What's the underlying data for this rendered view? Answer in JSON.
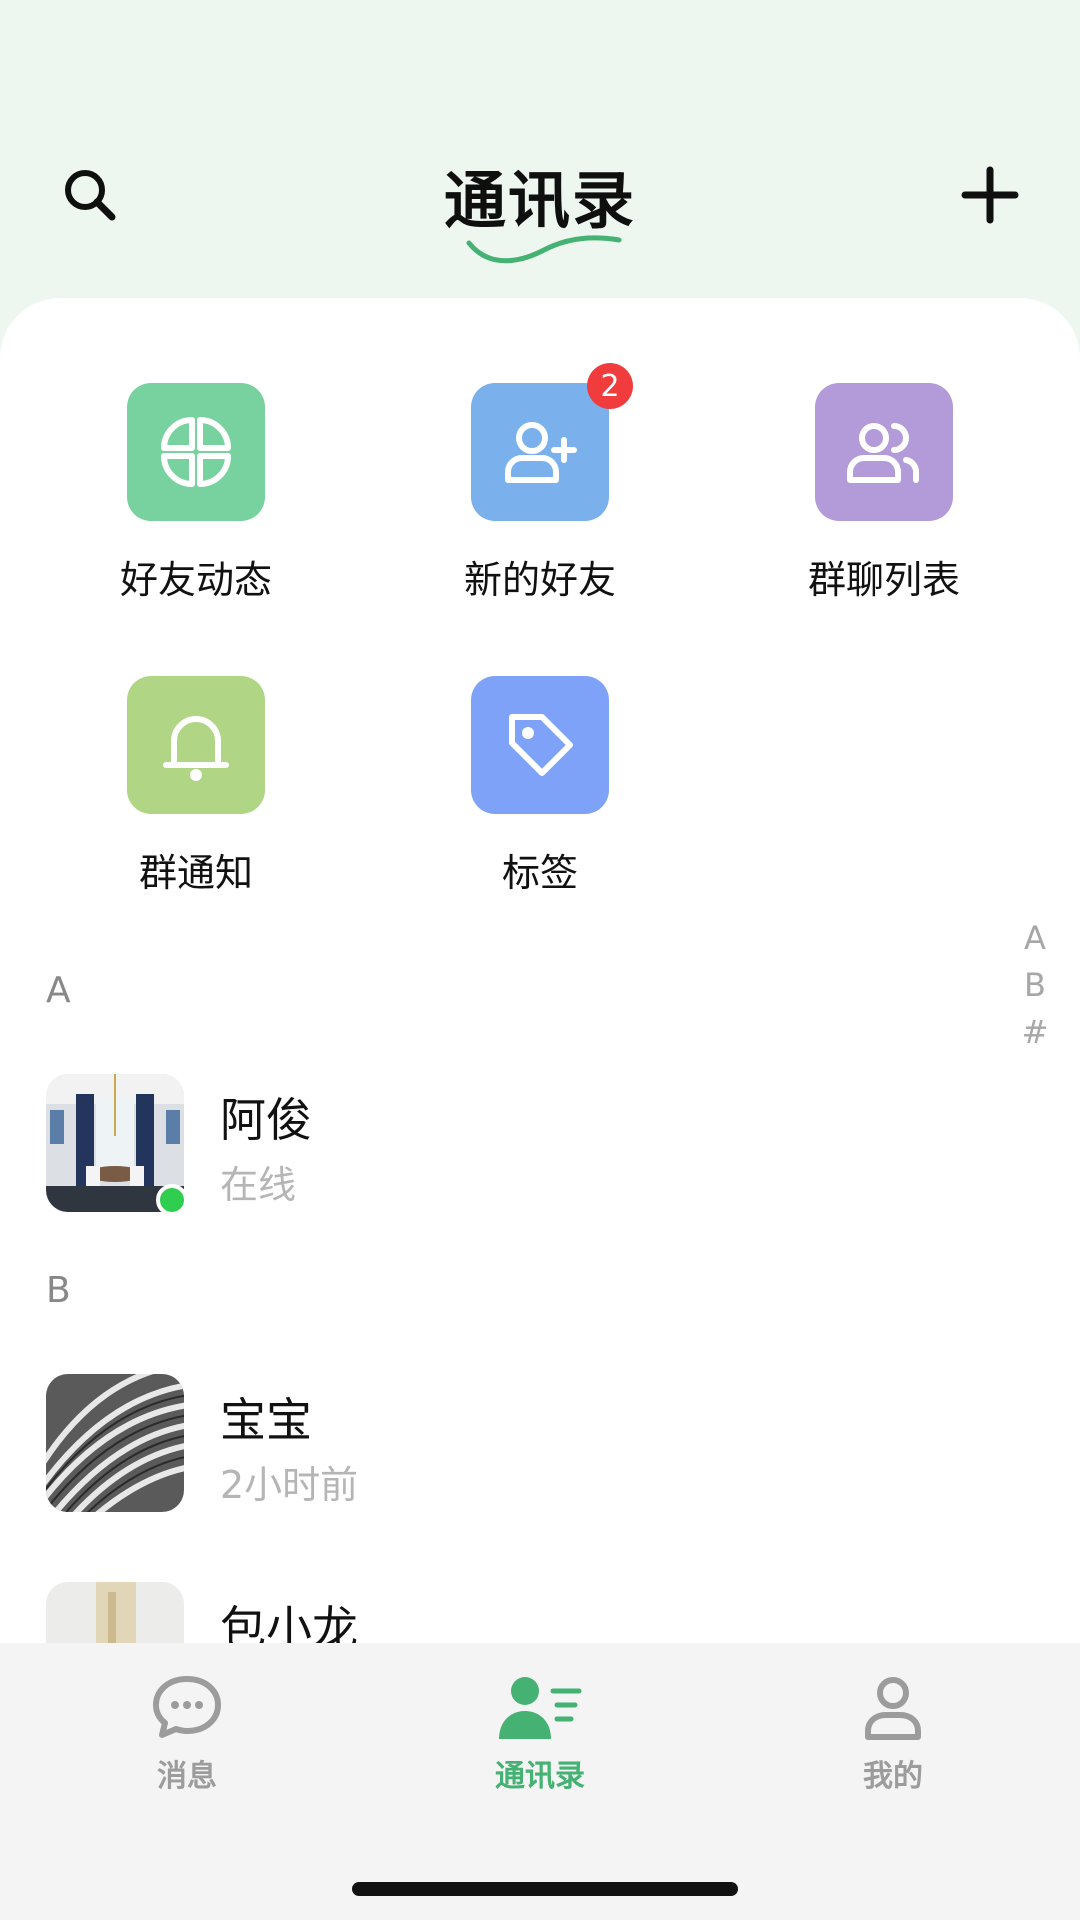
{
  "header": {
    "title": "通讯录",
    "search_icon": "search-icon",
    "add_icon": "plus-icon",
    "accent": "#45b173"
  },
  "shortcuts": [
    {
      "label": "好友动态",
      "icon": "pinwheel-icon",
      "color": "#78d29f"
    },
    {
      "label": "新的好友",
      "icon": "add-user-icon",
      "color": "#7ab0ec",
      "badge": "2"
    },
    {
      "label": "群聊列表",
      "icon": "users-icon",
      "color": "#b29bd8"
    },
    {
      "label": "群通知",
      "icon": "bell-icon",
      "color": "#afd585"
    },
    {
      "label": "标签",
      "icon": "tag-icon",
      "color": "#7fa2f9"
    }
  ],
  "sections": [
    {
      "letter": "A",
      "contacts": [
        {
          "name": "阿俊",
          "status": "在线",
          "online": true
        }
      ]
    },
    {
      "letter": "B",
      "contacts": [
        {
          "name": "宝宝",
          "status": "2小时前",
          "online": false
        },
        {
          "name": "包小龙",
          "status": "",
          "online": false
        }
      ]
    }
  ],
  "index_bar": [
    "A",
    "B",
    "#"
  ],
  "tabbar": [
    {
      "label": "消息",
      "icon": "chat-icon",
      "active": false
    },
    {
      "label": "通讯录",
      "icon": "contacts-icon",
      "active": true
    },
    {
      "label": "我的",
      "icon": "profile-icon",
      "active": false
    }
  ],
  "colors": {
    "active_tab": "#45b173",
    "inactive_tab": "#9c9c9c",
    "badge": "#f03c3c",
    "online": "#2fce4f"
  }
}
